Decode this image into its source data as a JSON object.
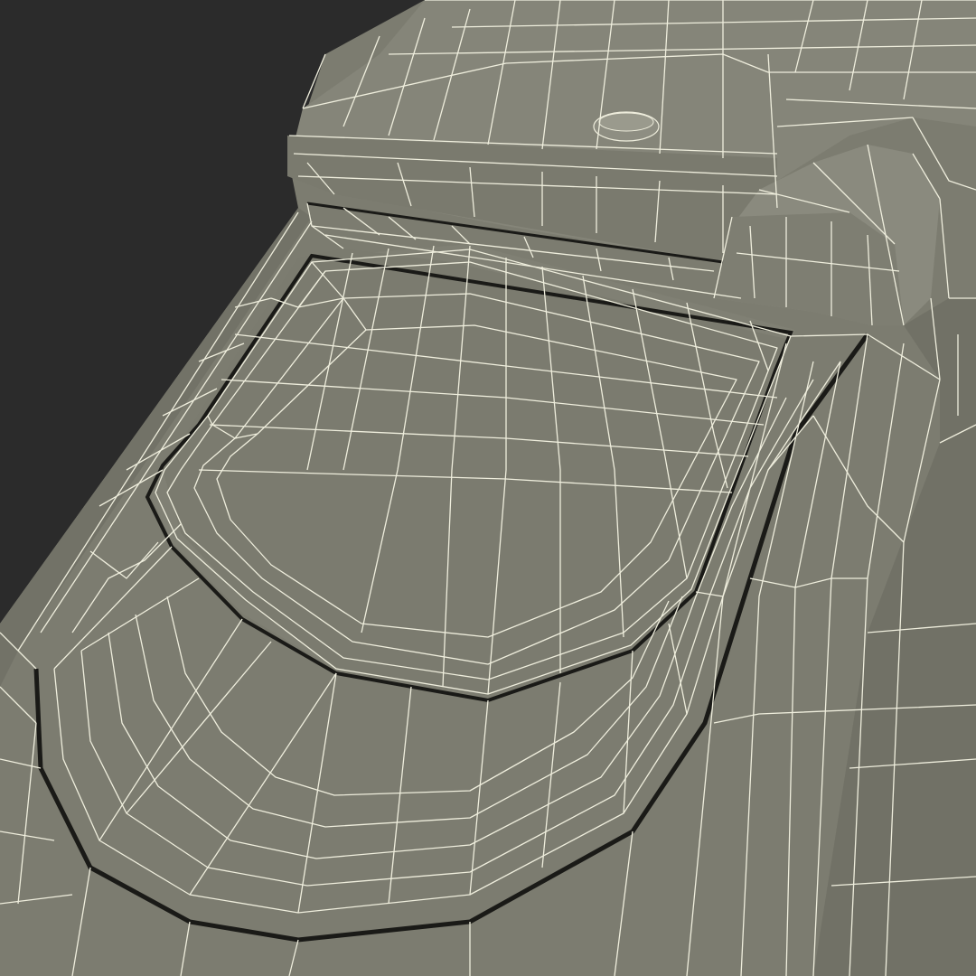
{
  "scene": {
    "subject": "wireframe-3d-model",
    "colors": {
      "background": "#2b2b2b",
      "surface": "#7c7c70",
      "surface_light": "#8a8a7e",
      "surface_dark": "#6a6a5f",
      "wire": "#efeedd",
      "seam": "#1a1a17"
    }
  }
}
